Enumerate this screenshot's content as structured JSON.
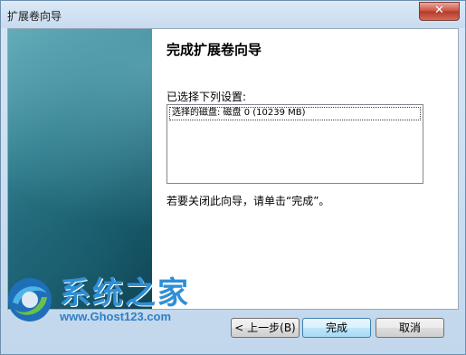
{
  "window": {
    "title": "扩展卷向导",
    "close_glyph": "✕"
  },
  "page": {
    "heading": "完成扩展卷向导",
    "settings_label": "已选择下列设置:",
    "settings_lines": [
      "选择的磁盘: 磁盘 0 (10239 MB)"
    ],
    "finish_hint": "若要关闭此向导，请单击“完成”。"
  },
  "buttons": {
    "back": "< 上一步(B)",
    "finish": "完成",
    "cancel": "取消"
  },
  "watermark": {
    "brand": "系统之家",
    "url": "www.Ghost123.com"
  }
}
